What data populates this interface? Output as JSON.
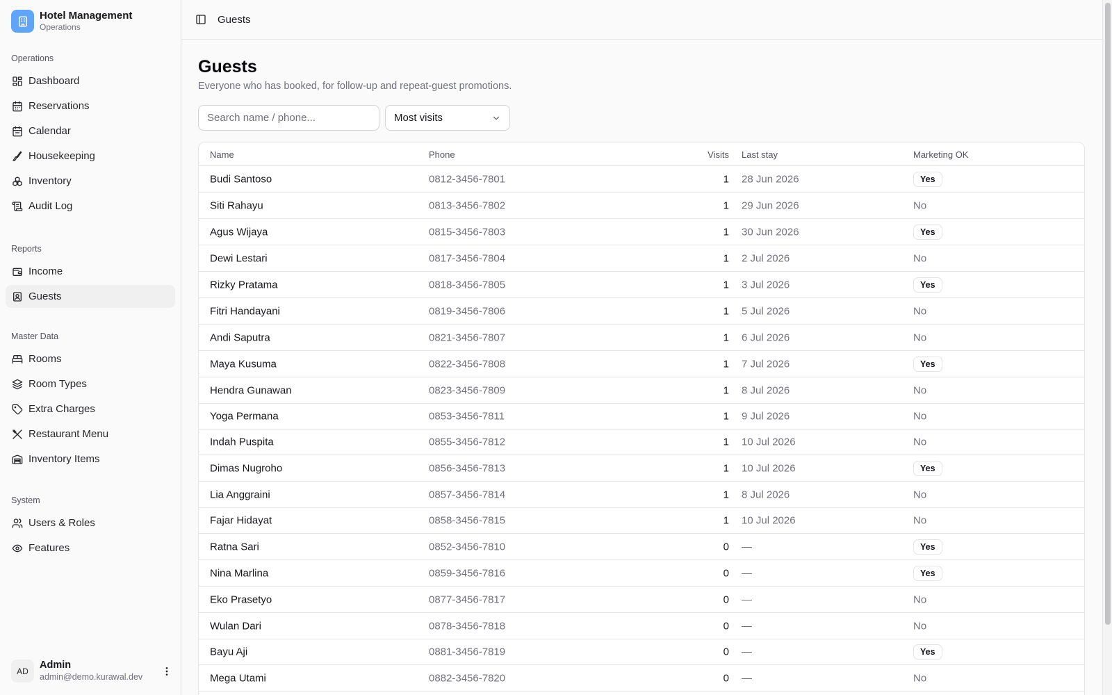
{
  "app": {
    "title": "Hotel Management",
    "subtitle": "Operations"
  },
  "sidebar": {
    "sections": [
      {
        "label": "Operations",
        "items": [
          {
            "label": "Dashboard",
            "icon": "dashboard-icon"
          },
          {
            "label": "Reservations",
            "icon": "calendar-icon"
          },
          {
            "label": "Calendar",
            "icon": "calendar-icon"
          },
          {
            "label": "Housekeeping",
            "icon": "brush-icon"
          },
          {
            "label": "Inventory",
            "icon": "boxes-icon"
          },
          {
            "label": "Audit Log",
            "icon": "scroll-icon"
          }
        ]
      },
      {
        "label": "Reports",
        "items": [
          {
            "label": "Income",
            "icon": "wallet-icon"
          },
          {
            "label": "Guests",
            "icon": "contact-icon",
            "active": true
          }
        ]
      },
      {
        "label": "Master Data",
        "items": [
          {
            "label": "Rooms",
            "icon": "bed-icon"
          },
          {
            "label": "Room Types",
            "icon": "layers-icon"
          },
          {
            "label": "Extra Charges",
            "icon": "tag-icon"
          },
          {
            "label": "Restaurant Menu",
            "icon": "utensils-icon"
          },
          {
            "label": "Inventory Items",
            "icon": "warehouse-icon"
          }
        ]
      },
      {
        "label": "System",
        "items": [
          {
            "label": "Users & Roles",
            "icon": "users-icon"
          },
          {
            "label": "Features",
            "icon": "eye-icon"
          }
        ]
      }
    ]
  },
  "user": {
    "initials": "AD",
    "name": "Admin",
    "email": "admin@demo.kurawal.dev"
  },
  "topbar": {
    "title": "Guests"
  },
  "page": {
    "title": "Guests",
    "description": "Everyone who has booked, for follow-up and repeat-guest promotions."
  },
  "filters": {
    "search_placeholder": "Search name / phone...",
    "sort_value": "Most visits"
  },
  "table": {
    "columns": [
      "Name",
      "Phone",
      "Visits",
      "Last stay",
      "Marketing OK"
    ],
    "rows": [
      {
        "name": "Budi Santoso",
        "phone": "0812-3456-7801",
        "visits": "1",
        "last_stay": "28 Jun 2026",
        "marketing": "Yes"
      },
      {
        "name": "Siti Rahayu",
        "phone": "0813-3456-7802",
        "visits": "1",
        "last_stay": "29 Jun 2026",
        "marketing": "No"
      },
      {
        "name": "Agus Wijaya",
        "phone": "0815-3456-7803",
        "visits": "1",
        "last_stay": "30 Jun 2026",
        "marketing": "Yes"
      },
      {
        "name": "Dewi Lestari",
        "phone": "0817-3456-7804",
        "visits": "1",
        "last_stay": "2 Jul 2026",
        "marketing": "No"
      },
      {
        "name": "Rizky Pratama",
        "phone": "0818-3456-7805",
        "visits": "1",
        "last_stay": "3 Jul 2026",
        "marketing": "Yes"
      },
      {
        "name": "Fitri Handayani",
        "phone": "0819-3456-7806",
        "visits": "1",
        "last_stay": "5 Jul 2026",
        "marketing": "No"
      },
      {
        "name": "Andi Saputra",
        "phone": "0821-3456-7807",
        "visits": "1",
        "last_stay": "6 Jul 2026",
        "marketing": "No"
      },
      {
        "name": "Maya Kusuma",
        "phone": "0822-3456-7808",
        "visits": "1",
        "last_stay": "7 Jul 2026",
        "marketing": "Yes"
      },
      {
        "name": "Hendra Gunawan",
        "phone": "0823-3456-7809",
        "visits": "1",
        "last_stay": "8 Jul 2026",
        "marketing": "No"
      },
      {
        "name": "Yoga Permana",
        "phone": "0853-3456-7811",
        "visits": "1",
        "last_stay": "9 Jul 2026",
        "marketing": "No"
      },
      {
        "name": "Indah Puspita",
        "phone": "0855-3456-7812",
        "visits": "1",
        "last_stay": "10 Jul 2026",
        "marketing": "No"
      },
      {
        "name": "Dimas Nugroho",
        "phone": "0856-3456-7813",
        "visits": "1",
        "last_stay": "10 Jul 2026",
        "marketing": "Yes"
      },
      {
        "name": "Lia Anggraini",
        "phone": "0857-3456-7814",
        "visits": "1",
        "last_stay": "8 Jul 2026",
        "marketing": "No"
      },
      {
        "name": "Fajar Hidayat",
        "phone": "0858-3456-7815",
        "visits": "1",
        "last_stay": "10 Jul 2026",
        "marketing": "No"
      },
      {
        "name": "Ratna Sari",
        "phone": "0852-3456-7810",
        "visits": "0",
        "last_stay": "—",
        "marketing": "Yes"
      },
      {
        "name": "Nina Marlina",
        "phone": "0859-3456-7816",
        "visits": "0",
        "last_stay": "—",
        "marketing": "Yes"
      },
      {
        "name": "Eko Prasetyo",
        "phone": "0877-3456-7817",
        "visits": "0",
        "last_stay": "—",
        "marketing": "No"
      },
      {
        "name": "Wulan Dari",
        "phone": "0878-3456-7818",
        "visits": "0",
        "last_stay": "—",
        "marketing": "No"
      },
      {
        "name": "Bayu Aji",
        "phone": "0881-3456-7819",
        "visits": "0",
        "last_stay": "—",
        "marketing": "Yes"
      },
      {
        "name": "Mega Utami",
        "phone": "0882-3456-7820",
        "visits": "0",
        "last_stay": "—",
        "marketing": "No"
      }
    ]
  },
  "colors": {
    "brand": "#60a5fa",
    "border": "#e5e5e5",
    "muted_text": "#71717a"
  }
}
